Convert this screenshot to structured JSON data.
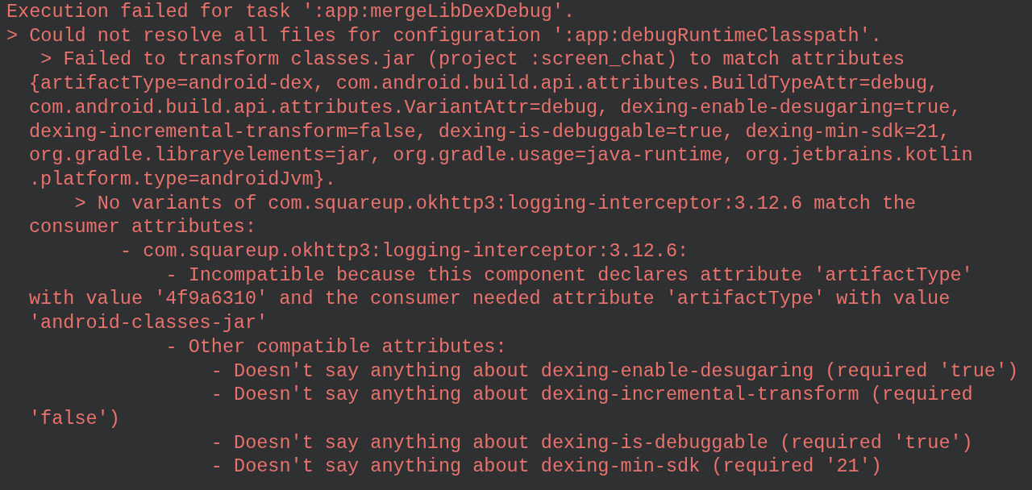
{
  "console": {
    "lines": [
      {
        "kind": "line",
        "text": "Execution failed for task ':app:mergeLibDexDebug'."
      },
      {
        "kind": "line",
        "text": "> Could not resolve all files for configuration ':app:debugRuntimeClasspath'."
      },
      {
        "kind": "line",
        "text": "   > Failed to transform classes.jar (project :screen_chat) to match attributes"
      },
      {
        "kind": "wrap",
        "text": "{artifactType=android-dex, com.android.build.api.attributes.BuildTypeAttr=debug,"
      },
      {
        "kind": "wrap",
        "text": "com.android.build.api.attributes.VariantAttr=debug, dexing-enable-desugaring=true,"
      },
      {
        "kind": "wrap",
        "text": "dexing-incremental-transform=false, dexing-is-debuggable=true, dexing-min-sdk=21,"
      },
      {
        "kind": "wrap",
        "text": "org.gradle.libraryelements=jar, org.gradle.usage=java-runtime, org.jetbrains.kotlin"
      },
      {
        "kind": "wrap",
        "text": ".platform.type=androidJvm}."
      },
      {
        "kind": "line",
        "text": "      > No variants of com.squareup.okhttp3:logging-interceptor:3.12.6 match the"
      },
      {
        "kind": "wrap",
        "text": "consumer attributes:"
      },
      {
        "kind": "line",
        "text": "          - com.squareup.okhttp3:logging-interceptor:3.12.6:"
      },
      {
        "kind": "line",
        "text": "              - Incompatible because this component declares attribute 'artifactType'"
      },
      {
        "kind": "wrap",
        "text": "with value '4f9a6310' and the consumer needed attribute 'artifactType' with value"
      },
      {
        "kind": "wrap",
        "text": "'android-classes-jar'"
      },
      {
        "kind": "line",
        "text": "              - Other compatible attributes:"
      },
      {
        "kind": "line",
        "text": "                  - Doesn't say anything about dexing-enable-desugaring (required 'true')"
      },
      {
        "kind": "line",
        "text": "                  - Doesn't say anything about dexing-incremental-transform (required"
      },
      {
        "kind": "wrap",
        "text": "'false')"
      },
      {
        "kind": "line",
        "text": "                  - Doesn't say anything about dexing-is-debuggable (required 'true')"
      },
      {
        "kind": "line",
        "text": "                  - Doesn't say anything about dexing-min-sdk (required '21')"
      }
    ]
  }
}
